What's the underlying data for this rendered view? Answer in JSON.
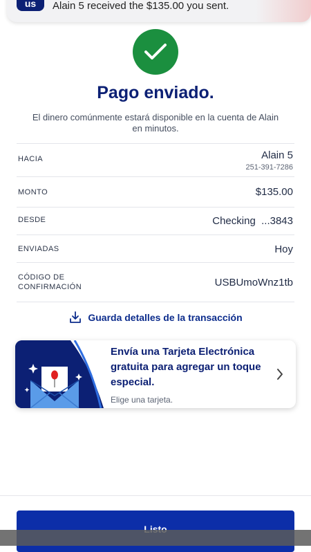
{
  "notification": {
    "app_logo_text": "us",
    "message": "Alain 5 received the $135.00 you sent."
  },
  "status": {
    "title": "Pago enviado.",
    "subtitle": "El dinero comúnmente estará disponible en la cuenta de Alain en minutos."
  },
  "details": [
    {
      "label": "HACIA",
      "value": "Alain 5",
      "subvalue": "251-391-7286"
    },
    {
      "label": "MONTO",
      "value": "$135.00"
    },
    {
      "label": "DESDE",
      "value": "Checking  ...3843"
    },
    {
      "label": "ENVIADAS",
      "value": "Hoy"
    },
    {
      "label": "CÓDIGO DE CONFIRMACIÓN",
      "value": "USBUmoWnz1tb"
    }
  ],
  "save_link": "Guarda detalles de la transacción",
  "ecard": {
    "title": "Envía una Tarjeta Electrónica gratuita para agregar un toque especial.",
    "subtitle": "Elige una tarjeta."
  },
  "done_button": "Listo",
  "colors": {
    "brand_navy": "#0c2074",
    "success_green": "#1b8f3f",
    "button_blue": "#0c2ea8"
  }
}
